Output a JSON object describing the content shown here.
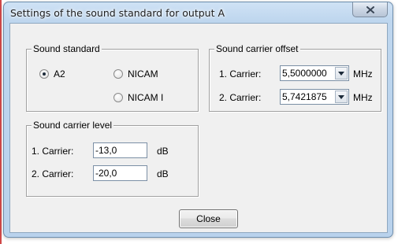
{
  "window": {
    "title": "Settings of the sound standard for output A",
    "close_icon": "close-x-icon"
  },
  "sound_standard": {
    "legend": "Sound standard",
    "options": [
      {
        "label": "A2",
        "checked": true
      },
      {
        "label": "NICAM",
        "checked": false
      },
      {
        "label": "NICAM I",
        "checked": false
      }
    ]
  },
  "carrier_offset": {
    "legend": "Sound carrier offset",
    "rows": [
      {
        "label": "1. Carrier:",
        "value": "5,5000000",
        "unit": "MHz"
      },
      {
        "label": "2. Carrier:",
        "value": "5,7421875",
        "unit": "MHz"
      }
    ],
    "dropdown_icon": "chevron-down-icon"
  },
  "carrier_level": {
    "legend": "Sound carrier level",
    "rows": [
      {
        "label": "1. Carrier:",
        "value": "-13,0",
        "unit": "dB"
      },
      {
        "label": "2. Carrier:",
        "value": "-20,0",
        "unit": "dB"
      }
    ]
  },
  "footer": {
    "close_label": "Close"
  }
}
